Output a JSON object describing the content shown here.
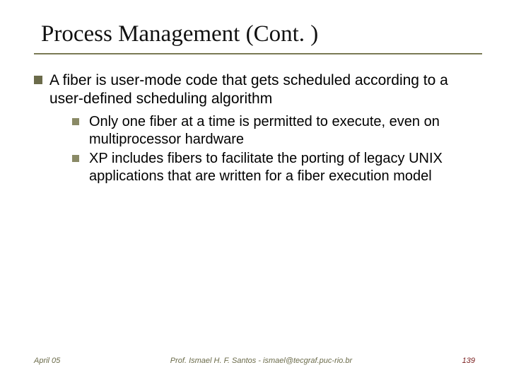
{
  "title": "Process Management (Cont. )",
  "main_bullet": "A fiber is user-mode code that gets scheduled according to a user-defined scheduling algorithm",
  "sub_bullets": [
    "Only one fiber at a time is permitted to execute, even on multiprocessor hardware",
    "XP includes fibers to facilitate the porting of legacy UNIX applications that are written for a fiber execution model"
  ],
  "footer": {
    "left": "April 05",
    "center": "Prof. Ismael H. F. Santos  -  ismael@tecgraf.puc-rio.br",
    "right": "139"
  }
}
